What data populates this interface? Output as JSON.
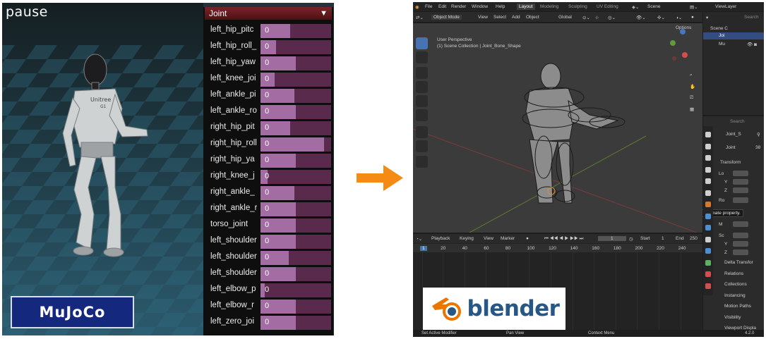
{
  "mujoco": {
    "status": "pause",
    "brand": "MuJoCo",
    "robot_brand": "Unitree",
    "robot_model": "G1",
    "joint_panel": {
      "title": "Joint",
      "rows": [
        {
          "name": "left_hip_pitc",
          "value": "0",
          "level": 0.42
        },
        {
          "name": "left_hip_roll_",
          "value": "0",
          "level": 0.22
        },
        {
          "name": "left_hip_yaw",
          "value": "0",
          "level": 0.5
        },
        {
          "name": "left_knee_joi",
          "value": "0",
          "level": 0.2
        },
        {
          "name": "left_ankle_pi",
          "value": "0",
          "level": 0.48
        },
        {
          "name": "left_ankle_ro",
          "value": "0",
          "level": 0.5
        },
        {
          "name": "right_hip_pit",
          "value": "0",
          "level": 0.42
        },
        {
          "name": "right_hip_roll",
          "value": "0",
          "level": 0.9
        },
        {
          "name": "right_hip_ya",
          "value": "0",
          "level": 0.5
        },
        {
          "name": "right_knee_j",
          "value": "0",
          "level": 0.1
        },
        {
          "name": "right_ankle_",
          "value": "0",
          "level": 0.48
        },
        {
          "name": "right_ankle_r",
          "value": "0",
          "level": 0.5
        },
        {
          "name": "torso_joint",
          "value": "0",
          "level": 0.5
        },
        {
          "name": "left_shoulder",
          "value": "0",
          "level": 0.5
        },
        {
          "name": "left_shoulder",
          "value": "0",
          "level": 0.4
        },
        {
          "name": "left_shoulder",
          "value": "0",
          "level": 0.5
        },
        {
          "name": "left_elbow_p",
          "value": "0",
          "level": 0.06
        },
        {
          "name": "left_elbow_r",
          "value": "0",
          "level": 0.5
        },
        {
          "name": "left_zero_joi",
          "value": "0",
          "level": 0.5
        }
      ]
    }
  },
  "blender": {
    "menu": [
      "File",
      "Edit",
      "Render",
      "Window",
      "Help"
    ],
    "workspace_tabs": [
      "Layout",
      "Modeling",
      "Sculpting",
      "UV Editing"
    ],
    "scene_name": "Scene",
    "view_layer": "ViewLayer",
    "viewport_header": {
      "mode": "Object Mode",
      "menus": [
        "View",
        "Select",
        "Add",
        "Object"
      ],
      "transform": "Global",
      "options": "Options"
    },
    "viewport": {
      "perspective": "User Perspective",
      "collection_path": "(1) Scene Collection | Joint_Bone_Shape"
    },
    "outliner": {
      "items": [
        "Scene C",
        "Joi",
        "Mu"
      ],
      "search_placeholder": "Search"
    },
    "properties": {
      "object_name": "Joint_S",
      "data_name": "Joint",
      "data_count": "38",
      "transform_label": "Transform",
      "rows": [
        "Lo",
        "Y",
        "Z",
        "Ro",
        "M",
        "Sc",
        "Y",
        "Z"
      ],
      "tooltip": "Animate property.",
      "sections": [
        "Delta Transfor",
        "Relations",
        "Collections",
        "Instancing",
        "Motion Paths",
        "Visibility",
        "Viewport Displa"
      ],
      "search_placeholder": "Search"
    },
    "timeline": {
      "menus": [
        "Playback",
        "Keying",
        "View",
        "Marker"
      ],
      "current_frame": "1",
      "start_label": "Start",
      "start": "1",
      "end_label": "End",
      "end": "250",
      "ruler": [
        "1",
        "20",
        "40",
        "60",
        "80",
        "100",
        "120",
        "140",
        "160",
        "180",
        "200",
        "220",
        "240"
      ]
    },
    "status_bar": {
      "left": "Set Active Modifier",
      "middle": "Pan View",
      "right": "Context Menu",
      "version": "4.2.0"
    },
    "brand": "blender"
  }
}
